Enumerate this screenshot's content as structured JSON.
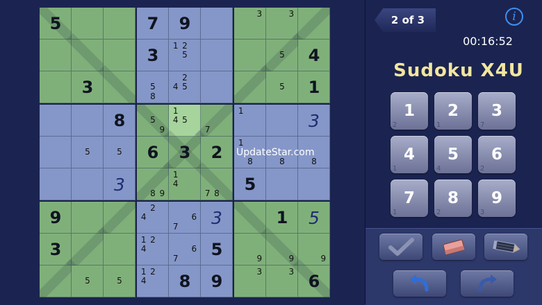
{
  "board": {
    "rows": [
      [
        {
          "v": "5",
          "bg": "green",
          "diag": true
        },
        {
          "bg": "green"
        },
        {
          "bg": "green"
        },
        {
          "v": "7",
          "bg": "blue"
        },
        {
          "v": "9",
          "bg": "blue"
        },
        {
          "bg": "blue"
        },
        {
          "n": [
            3
          ],
          "bg": "green"
        },
        {
          "n": [
            3
          ],
          "bg": "green"
        },
        {
          "bg": "green",
          "anti": true
        }
      ],
      [
        {
          "bg": "green"
        },
        {
          "bg": "green",
          "diag": true
        },
        {
          "bg": "green"
        },
        {
          "v": "3",
          "bg": "blue"
        },
        {
          "n": [
            1,
            2,
            5
          ],
          "bg": "blue"
        },
        {
          "bg": "blue"
        },
        {
          "bg": "green"
        },
        {
          "n": [
            5
          ],
          "bg": "green",
          "anti": true
        },
        {
          "v": "4",
          "bg": "green"
        }
      ],
      [
        {
          "bg": "green"
        },
        {
          "v": "3",
          "bg": "green"
        },
        {
          "bg": "green",
          "diag": true
        },
        {
          "n": [
            5,
            8
          ],
          "bg": "blue"
        },
        {
          "n": [
            2,
            4,
            5
          ],
          "bg": "blue"
        },
        {
          "bg": "blue"
        },
        {
          "bg": "green",
          "anti": true
        },
        {
          "n": [
            5
          ],
          "bg": "green"
        },
        {
          "v": "1",
          "bg": "green"
        }
      ],
      [
        {
          "bg": "blue"
        },
        {
          "bg": "blue"
        },
        {
          "v": "8",
          "bg": "blue"
        },
        {
          "n": [
            5,
            9
          ],
          "bg": "green",
          "diag": true
        },
        {
          "n": [
            1,
            4,
            5
          ],
          "bg": "sel"
        },
        {
          "n": [
            7
          ],
          "bg": "green",
          "anti": true
        },
        {
          "n": [
            1
          ],
          "bg": "blue"
        },
        {
          "bg": "blue"
        },
        {
          "v": "3",
          "bg": "blue",
          "user": true
        }
      ],
      [
        {
          "bg": "blue"
        },
        {
          "n": [
            5
          ],
          "bg": "blue"
        },
        {
          "n": [
            5
          ],
          "bg": "blue"
        },
        {
          "v": "6",
          "bg": "green"
        },
        {
          "v": "3",
          "bg": "green",
          "diag": true,
          "anti": true
        },
        {
          "v": "2",
          "bg": "green"
        },
        {
          "n": [
            1,
            8
          ],
          "bg": "blue"
        },
        {
          "n": [
            8
          ],
          "bg": "blue"
        },
        {
          "n": [
            8
          ],
          "bg": "blue"
        }
      ],
      [
        {
          "bg": "blue"
        },
        {
          "bg": "blue"
        },
        {
          "v": "3",
          "bg": "blue",
          "user": true
        },
        {
          "n": [
            8,
            9
          ],
          "bg": "green",
          "anti": true
        },
        {
          "n": [
            1,
            4
          ],
          "bg": "green"
        },
        {
          "n": [
            7,
            8
          ],
          "bg": "green",
          "diag": true
        },
        {
          "v": "5",
          "bg": "blue"
        },
        {
          "bg": "blue"
        },
        {
          "bg": "blue"
        }
      ],
      [
        {
          "v": "9",
          "bg": "green"
        },
        {
          "bg": "green"
        },
        {
          "bg": "green",
          "anti": true
        },
        {
          "n": [
            2,
            4
          ],
          "bg": "blue"
        },
        {
          "n": [
            6,
            7
          ],
          "bg": "blue"
        },
        {
          "v": "3",
          "bg": "blue",
          "user": true
        },
        {
          "bg": "green",
          "diag": true
        },
        {
          "v": "1",
          "bg": "green"
        },
        {
          "v": "5",
          "bg": "green",
          "user": true
        }
      ],
      [
        {
          "v": "3",
          "bg": "green"
        },
        {
          "bg": "green",
          "anti": true
        },
        {
          "bg": "green"
        },
        {
          "n": [
            1,
            2,
            4
          ],
          "bg": "blue"
        },
        {
          "n": [
            6,
            7
          ],
          "bg": "blue"
        },
        {
          "v": "5",
          "bg": "blue"
        },
        {
          "n": [
            9
          ],
          "bg": "green"
        },
        {
          "n": [
            9
          ],
          "bg": "green",
          "diag": true
        },
        {
          "n": [
            9
          ],
          "bg": "green"
        }
      ],
      [
        {
          "bg": "green",
          "anti": true
        },
        {
          "n": [
            5
          ],
          "bg": "green"
        },
        {
          "n": [
            5
          ],
          "bg": "green"
        },
        {
          "n": [
            1,
            2,
            4
          ],
          "bg": "blue"
        },
        {
          "v": "8",
          "bg": "blue"
        },
        {
          "v": "9",
          "bg": "blue"
        },
        {
          "n": [
            3
          ],
          "bg": "green"
        },
        {
          "n": [
            3
          ],
          "bg": "green"
        },
        {
          "v": "6",
          "bg": "green",
          "diag": true
        }
      ]
    ]
  },
  "watermark": "UpdateStar.com",
  "nav": {
    "back_label": "2 of 3",
    "info_label": "i"
  },
  "timer": "00:16:52",
  "title": "Sudoku X4U",
  "keypad": [
    {
      "digit": "1",
      "count": "2"
    },
    {
      "digit": "2",
      "count": "1"
    },
    {
      "digit": "3",
      "count": "7"
    },
    {
      "digit": "4",
      "count": "1"
    },
    {
      "digit": "5",
      "count": "4"
    },
    {
      "digit": "6",
      "count": "2"
    },
    {
      "digit": "7",
      "count": "1"
    },
    {
      "digit": "8",
      "count": "2"
    },
    {
      "digit": "9",
      "count": "3"
    }
  ],
  "toolbar": {
    "icons": [
      "checkmark-icon",
      "eraser-icon",
      "pencil-icon",
      "undo-icon",
      "redo-icon"
    ]
  },
  "colors": {
    "background": "#1b2450",
    "cell_green": "#80b07a",
    "cell_blue": "#8597c8",
    "cell_selected": "#a6d49c",
    "title": "#f2e6a0",
    "info": "#3f8ff0"
  }
}
